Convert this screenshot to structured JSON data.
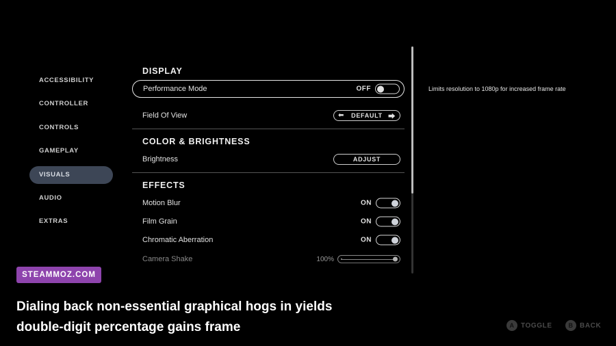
{
  "sidebar": {
    "items": [
      {
        "label": "ACCESSIBILITY"
      },
      {
        "label": "CONTROLLER"
      },
      {
        "label": "CONTROLS"
      },
      {
        "label": "GAMEPLAY"
      },
      {
        "label": "VISUALS"
      },
      {
        "label": "AUDIO"
      },
      {
        "label": "EXTRAS"
      }
    ],
    "active": "VISUALS"
  },
  "display": {
    "title": "DISPLAY",
    "performance_mode": {
      "label": "Performance Mode",
      "state": "OFF"
    },
    "field_of_view": {
      "label": "Field Of View",
      "value": "DEFAULT"
    }
  },
  "color": {
    "title": "COLOR & BRIGHTNESS",
    "brightness": {
      "label": "Brightness",
      "button": "ADJUST"
    }
  },
  "effects": {
    "title": "EFFECTS",
    "motion_blur": {
      "label": "Motion Blur",
      "state": "ON"
    },
    "film_grain": {
      "label": "Film Grain",
      "state": "ON"
    },
    "chromatic_aberration": {
      "label": "Chromatic Aberration",
      "state": "ON"
    },
    "camera_shake": {
      "label": "Camera Shake",
      "value": "100%",
      "level": 1.0
    }
  },
  "description": "Limits resolution to 1080p for increased frame rate",
  "watermark": "STEAMMOZ.COM",
  "caption": "Dialing back non-essential graphical hogs in yields double-digit percentage gains frame",
  "footer": {
    "toggle": {
      "button": "A",
      "label": "TOGGLE"
    },
    "back": {
      "button": "B",
      "label": "BACK"
    }
  },
  "colors": {
    "active_tab": "#3d4656",
    "badge": "#8e44ad"
  }
}
